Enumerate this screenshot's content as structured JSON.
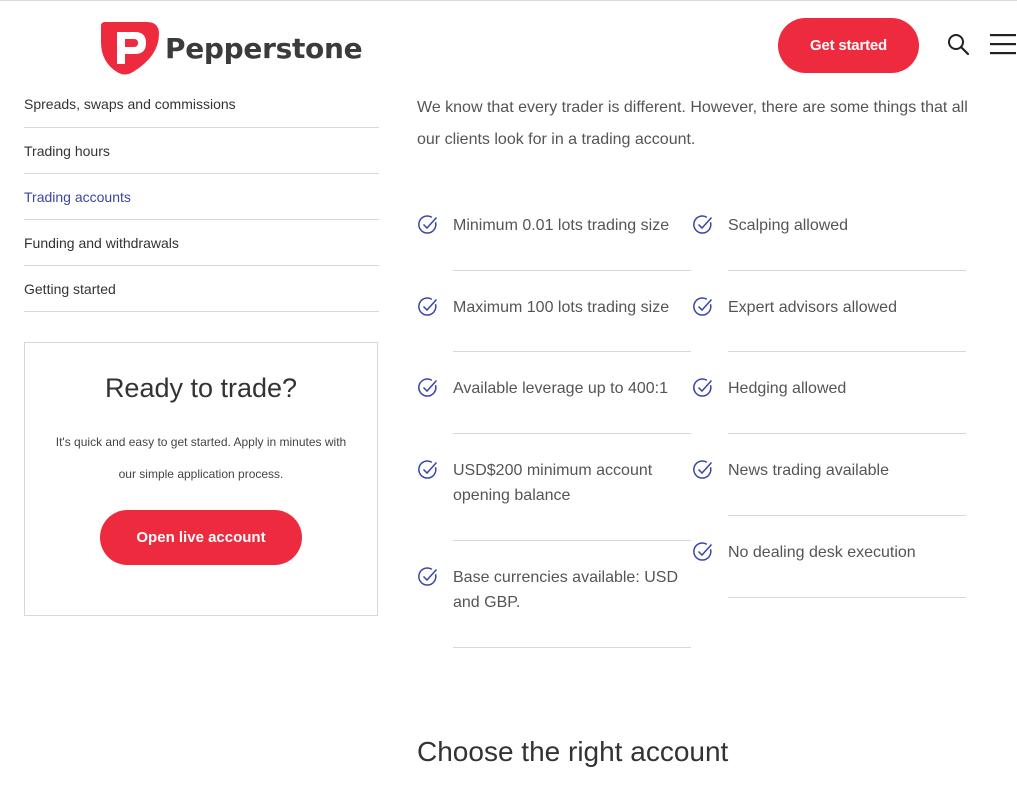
{
  "header": {
    "brand": "Pepperstone",
    "get_started": "Get started",
    "icons": {
      "search": "search-icon",
      "menu": "hamburger-menu-icon",
      "logo": "pepperstone-logo-icon"
    },
    "accent_color": "#ee2a3e"
  },
  "sidebar": {
    "items": [
      {
        "label": "Spreads, swaps and commissions"
      },
      {
        "label": "Trading hours"
      },
      {
        "label": "Trading accounts",
        "active": true
      },
      {
        "label": "Funding and withdrawals"
      },
      {
        "label": "Getting started"
      }
    ],
    "active_color": "#3a45a8"
  },
  "cta": {
    "title": "Ready to trade?",
    "text": "It's quick and easy to get started. Apply in minutes with our simple application process.",
    "button": "Open live account"
  },
  "main": {
    "intro": "We know that every trader is different. However, there are some things that all our clients look for in a trading account.",
    "features_left": [
      "Minimum 0.01 lots trading size",
      "Maximum 100 lots trading size",
      "Available leverage up to 400:1",
      "USD$200 minimum account opening balance",
      "Base currencies available: USD and GBP."
    ],
    "features_right": [
      "Scalping allowed",
      "Expert advisors allowed",
      "Hedging allowed",
      "News trading available",
      "No dealing desk execution"
    ],
    "check_icon": "check-circle-icon",
    "section_title": "Choose the right account"
  }
}
